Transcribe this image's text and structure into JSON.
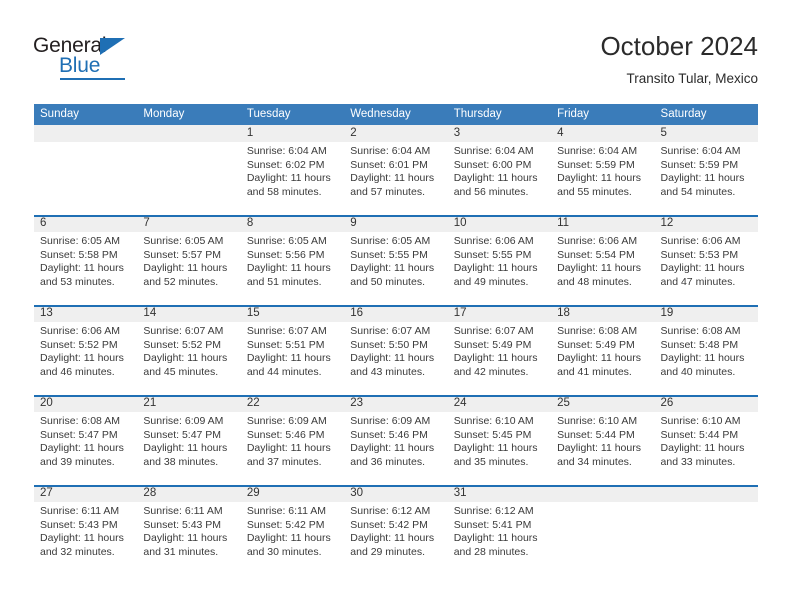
{
  "brand": {
    "name_top": "General",
    "name_bottom": "Blue",
    "accent_color": "#1f6fb4"
  },
  "header": {
    "title": "October 2024",
    "subtitle": "Transito Tular, Mexico"
  },
  "calendar": {
    "header_bg": "#3a7cba",
    "daynum_bg": "#efefef",
    "separator_color": "#1f6fb4",
    "weekdays": [
      "Sunday",
      "Monday",
      "Tuesday",
      "Wednesday",
      "Thursday",
      "Friday",
      "Saturday"
    ],
    "weeks": [
      [
        {
          "day": "",
          "lines": []
        },
        {
          "day": "",
          "lines": []
        },
        {
          "day": "1",
          "lines": [
            "Sunrise: 6:04 AM",
            "Sunset: 6:02 PM",
            "Daylight: 11 hours",
            "and 58 minutes."
          ]
        },
        {
          "day": "2",
          "lines": [
            "Sunrise: 6:04 AM",
            "Sunset: 6:01 PM",
            "Daylight: 11 hours",
            "and 57 minutes."
          ]
        },
        {
          "day": "3",
          "lines": [
            "Sunrise: 6:04 AM",
            "Sunset: 6:00 PM",
            "Daylight: 11 hours",
            "and 56 minutes."
          ]
        },
        {
          "day": "4",
          "lines": [
            "Sunrise: 6:04 AM",
            "Sunset: 5:59 PM",
            "Daylight: 11 hours",
            "and 55 minutes."
          ]
        },
        {
          "day": "5",
          "lines": [
            "Sunrise: 6:04 AM",
            "Sunset: 5:59 PM",
            "Daylight: 11 hours",
            "and 54 minutes."
          ]
        }
      ],
      [
        {
          "day": "6",
          "lines": [
            "Sunrise: 6:05 AM",
            "Sunset: 5:58 PM",
            "Daylight: 11 hours",
            "and 53 minutes."
          ]
        },
        {
          "day": "7",
          "lines": [
            "Sunrise: 6:05 AM",
            "Sunset: 5:57 PM",
            "Daylight: 11 hours",
            "and 52 minutes."
          ]
        },
        {
          "day": "8",
          "lines": [
            "Sunrise: 6:05 AM",
            "Sunset: 5:56 PM",
            "Daylight: 11 hours",
            "and 51 minutes."
          ]
        },
        {
          "day": "9",
          "lines": [
            "Sunrise: 6:05 AM",
            "Sunset: 5:55 PM",
            "Daylight: 11 hours",
            "and 50 minutes."
          ]
        },
        {
          "day": "10",
          "lines": [
            "Sunrise: 6:06 AM",
            "Sunset: 5:55 PM",
            "Daylight: 11 hours",
            "and 49 minutes."
          ]
        },
        {
          "day": "11",
          "lines": [
            "Sunrise: 6:06 AM",
            "Sunset: 5:54 PM",
            "Daylight: 11 hours",
            "and 48 minutes."
          ]
        },
        {
          "day": "12",
          "lines": [
            "Sunrise: 6:06 AM",
            "Sunset: 5:53 PM",
            "Daylight: 11 hours",
            "and 47 minutes."
          ]
        }
      ],
      [
        {
          "day": "13",
          "lines": [
            "Sunrise: 6:06 AM",
            "Sunset: 5:52 PM",
            "Daylight: 11 hours",
            "and 46 minutes."
          ]
        },
        {
          "day": "14",
          "lines": [
            "Sunrise: 6:07 AM",
            "Sunset: 5:52 PM",
            "Daylight: 11 hours",
            "and 45 minutes."
          ]
        },
        {
          "day": "15",
          "lines": [
            "Sunrise: 6:07 AM",
            "Sunset: 5:51 PM",
            "Daylight: 11 hours",
            "and 44 minutes."
          ]
        },
        {
          "day": "16",
          "lines": [
            "Sunrise: 6:07 AM",
            "Sunset: 5:50 PM",
            "Daylight: 11 hours",
            "and 43 minutes."
          ]
        },
        {
          "day": "17",
          "lines": [
            "Sunrise: 6:07 AM",
            "Sunset: 5:49 PM",
            "Daylight: 11 hours",
            "and 42 minutes."
          ]
        },
        {
          "day": "18",
          "lines": [
            "Sunrise: 6:08 AM",
            "Sunset: 5:49 PM",
            "Daylight: 11 hours",
            "and 41 minutes."
          ]
        },
        {
          "day": "19",
          "lines": [
            "Sunrise: 6:08 AM",
            "Sunset: 5:48 PM",
            "Daylight: 11 hours",
            "and 40 minutes."
          ]
        }
      ],
      [
        {
          "day": "20",
          "lines": [
            "Sunrise: 6:08 AM",
            "Sunset: 5:47 PM",
            "Daylight: 11 hours",
            "and 39 minutes."
          ]
        },
        {
          "day": "21",
          "lines": [
            "Sunrise: 6:09 AM",
            "Sunset: 5:47 PM",
            "Daylight: 11 hours",
            "and 38 minutes."
          ]
        },
        {
          "day": "22",
          "lines": [
            "Sunrise: 6:09 AM",
            "Sunset: 5:46 PM",
            "Daylight: 11 hours",
            "and 37 minutes."
          ]
        },
        {
          "day": "23",
          "lines": [
            "Sunrise: 6:09 AM",
            "Sunset: 5:46 PM",
            "Daylight: 11 hours",
            "and 36 minutes."
          ]
        },
        {
          "day": "24",
          "lines": [
            "Sunrise: 6:10 AM",
            "Sunset: 5:45 PM",
            "Daylight: 11 hours",
            "and 35 minutes."
          ]
        },
        {
          "day": "25",
          "lines": [
            "Sunrise: 6:10 AM",
            "Sunset: 5:44 PM",
            "Daylight: 11 hours",
            "and 34 minutes."
          ]
        },
        {
          "day": "26",
          "lines": [
            "Sunrise: 6:10 AM",
            "Sunset: 5:44 PM",
            "Daylight: 11 hours",
            "and 33 minutes."
          ]
        }
      ],
      [
        {
          "day": "27",
          "lines": [
            "Sunrise: 6:11 AM",
            "Sunset: 5:43 PM",
            "Daylight: 11 hours",
            "and 32 minutes."
          ]
        },
        {
          "day": "28",
          "lines": [
            "Sunrise: 6:11 AM",
            "Sunset: 5:43 PM",
            "Daylight: 11 hours",
            "and 31 minutes."
          ]
        },
        {
          "day": "29",
          "lines": [
            "Sunrise: 6:11 AM",
            "Sunset: 5:42 PM",
            "Daylight: 11 hours",
            "and 30 minutes."
          ]
        },
        {
          "day": "30",
          "lines": [
            "Sunrise: 6:12 AM",
            "Sunset: 5:42 PM",
            "Daylight: 11 hours",
            "and 29 minutes."
          ]
        },
        {
          "day": "31",
          "lines": [
            "Sunrise: 6:12 AM",
            "Sunset: 5:41 PM",
            "Daylight: 11 hours",
            "and 28 minutes."
          ]
        },
        {
          "day": "",
          "lines": []
        },
        {
          "day": "",
          "lines": []
        }
      ]
    ]
  }
}
